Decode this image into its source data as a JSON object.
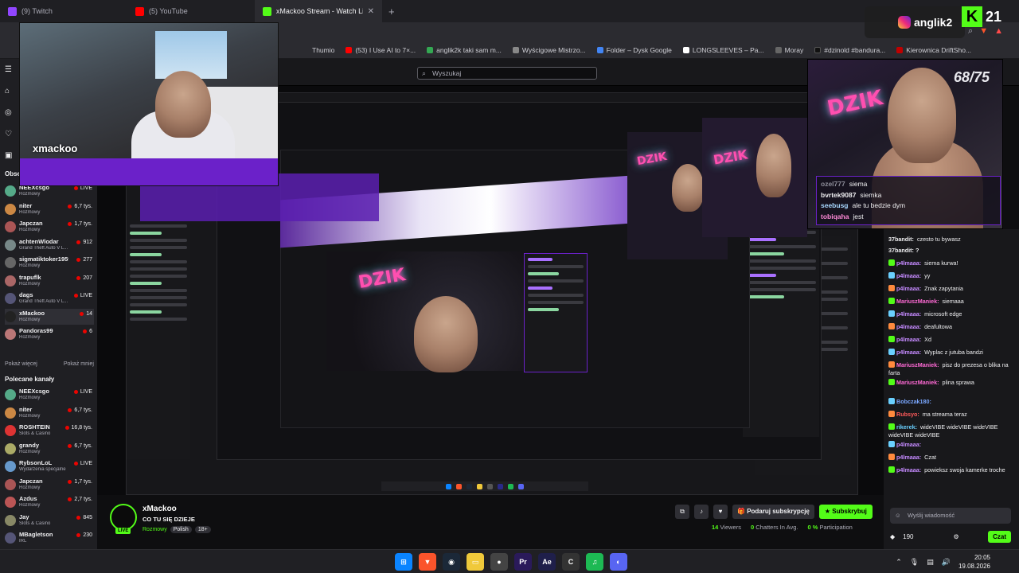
{
  "browser": {
    "tabs": [
      {
        "label": "(9) Twitch",
        "color": "#9146ff"
      },
      {
        "label": "(5) YouTube",
        "color": "#ff0000"
      },
      {
        "label": "xMackoo Stream - Watch Live o",
        "color": "#53fc18"
      }
    ],
    "bookmarks": [
      {
        "label": "Thumio",
        "color": "#3b3b3b"
      },
      {
        "label": "(53) I Use AI to 7×...",
        "color": "#ff0000"
      },
      {
        "label": "anglik2k taki sam m...",
        "color": "#34a853"
      },
      {
        "label": "Wyścigowe Mistrzo...",
        "color": "#888888"
      },
      {
        "label": "Folder – Dysk Google",
        "color": "#4285f4"
      },
      {
        "label": "LONGSLEEVES – Pa...",
        "color": "#ffffff"
      },
      {
        "label": "Moray",
        "color": "#666666"
      },
      {
        "label": "#dzinold #bandura...",
        "color": "#111111"
      },
      {
        "label": "Kierownica DriftSho...",
        "color": "#c00000"
      }
    ]
  },
  "search": {
    "placeholder": "Wyszukaj"
  },
  "sidebar": {
    "followed_title": "Obse",
    "channels": [
      {
        "name": "NEEXcsgo",
        "game": "Rozmowy",
        "viewers": "LIVE",
        "color": "#5a8"
      },
      {
        "name": "niter",
        "game": "Rozmowy",
        "viewers": "6,7 tys.",
        "color": "#c84"
      },
      {
        "name": "Japczan",
        "game": "Rozmowy",
        "viewers": "1,7 tys.",
        "color": "#a55"
      },
      {
        "name": "achtenWlodar",
        "game": "Grand Theft Auto V L...",
        "viewers": "912",
        "color": "#788"
      },
      {
        "name": "sigmatiktoker1959",
        "game": "Rozmowy",
        "viewers": "277",
        "color": "#666"
      },
      {
        "name": "trapuflk",
        "game": "Rozmowy",
        "viewers": "207",
        "color": "#a66"
      },
      {
        "name": "dags",
        "game": "Grand Theft Auto V L...",
        "viewers": "LIVE",
        "color": "#557"
      },
      {
        "name": "xMackoo",
        "game": "Rozmowy",
        "viewers": "14",
        "color": "#222"
      },
      {
        "name": "Pandoras99",
        "game": "Rozmowy",
        "viewers": "6",
        "color": "#b77"
      }
    ],
    "show_more": "Pokaż więcej",
    "show_less": "Pokaż mniej",
    "recommended_title": "Polecane kanały",
    "recommended": [
      {
        "name": "NEEXcsgo",
        "game": "Rozmowy",
        "viewers": "LIVE",
        "color": "#5a8"
      },
      {
        "name": "niter",
        "game": "Rozmowy",
        "viewers": "6,7 tys.",
        "color": "#c84"
      },
      {
        "name": "ROSHTEIN",
        "game": "Slots & Casino",
        "viewers": "16,8 tys.",
        "color": "#d33"
      },
      {
        "name": "grandy",
        "game": "Rozmowy",
        "viewers": "6,7 tys.",
        "color": "#aa6"
      },
      {
        "name": "RybsonLoL",
        "game": "Wydarzenia specjalne",
        "viewers": "LIVE",
        "color": "#69c"
      },
      {
        "name": "Japczan",
        "game": "Rozmowy",
        "viewers": "1,7 tys.",
        "color": "#a55"
      },
      {
        "name": "Azdus",
        "game": "Rozmowy",
        "viewers": "2,7 tys.",
        "color": "#b55"
      },
      {
        "name": "Jay",
        "game": "Slots & Casino",
        "viewers": "845",
        "color": "#886"
      },
      {
        "name": "MBagletson",
        "game": "IRL",
        "viewers": "230",
        "color": "#557"
      }
    ]
  },
  "overlay": {
    "cam_left_name": "xmackoo",
    "instagram_user": "anglik2",
    "kick_number": "21",
    "counter": "68/75",
    "neon_sign": "DZIK",
    "overlay_chat": [
      {
        "user": "ozel777",
        "text": "siema",
        "color": "#8e8e9a"
      },
      {
        "user": "bvrtek9087",
        "text": "siemka",
        "color": "#efeff1"
      },
      {
        "user": "seebusg",
        "text": "ale tu bedzie dym",
        "color": "#a8d8ff"
      },
      {
        "user": "tobiqaha",
        "text": "jest",
        "color": "#ff8ad8"
      }
    ]
  },
  "chat": {
    "messages": [
      {
        "user": "37bandit:",
        "text": "czesto tu bywasz",
        "color": "#efeff1"
      },
      {
        "user": "37bandit: ?",
        "text": "",
        "color": "#efeff1"
      },
      {
        "user": "p4lmaaa:",
        "text": "siema kurwa!",
        "color": "#c58aff"
      },
      {
        "user": "p4lmaaa:",
        "text": "yy",
        "color": "#c58aff"
      },
      {
        "user": "p4lmaaa:",
        "text": "Znak zapytania",
        "color": "#c58aff"
      },
      {
        "user": "MariuszManiek:",
        "text": "siemaaa",
        "color": "#ff6ad5"
      },
      {
        "user": "p4lmaaa:",
        "text": "microsoft edge",
        "color": "#c58aff"
      },
      {
        "user": "p4lmaaa:",
        "text": "deafultowa",
        "color": "#c58aff"
      },
      {
        "user": "p4lmaaa:",
        "text": "Xd",
        "color": "#c58aff"
      },
      {
        "user": "p4lmaaa:",
        "text": "Wyplac z jutuba bandzi",
        "color": "#c58aff"
      },
      {
        "user": "MariuszManiek:",
        "text": "pisz do prezesa o blika na farta",
        "color": "#ff6ad5"
      },
      {
        "user": "MariuszManiek:",
        "text": "plina sprawa",
        "color": "#ff6ad5"
      },
      {
        "user": "Bobczak180:",
        "text": "",
        "color": "#7aa7ff"
      },
      {
        "user": "Rubsyo:",
        "text": "ma streama teraz",
        "color": "#ff5a5a"
      },
      {
        "user": "rikerek:",
        "text": "wideVIBE wideVIBE wideVIBE wideVIBE wideVIBE",
        "color": "#6ad0ff"
      },
      {
        "user": "p4lmaaa:",
        "text": "",
        "color": "#c58aff"
      },
      {
        "user": "p4lmaaa:",
        "text": "Czat",
        "color": "#c58aff"
      },
      {
        "user": "p4lmaaa:",
        "text": "powieksz swoja kamerke troche",
        "color": "#c58aff"
      }
    ],
    "input_placeholder": "Wyślij wiadomość",
    "points": "190",
    "send_label": "Czat"
  },
  "stream": {
    "name": "xMackoo",
    "title": "CO TU SIĘ DZIEJE",
    "category": "Rozmowy",
    "language": "Polish",
    "age": "18+",
    "live_badge": "LIVE",
    "gift_label": "Podaruj subskrypcję",
    "sub_label": "Subskrybuj",
    "viewers": "14",
    "viewers_label": "Viewers",
    "chatters": "0",
    "chatters_label": "Chatters In Avg.",
    "participation": "0 %",
    "participation_label": "Participation"
  },
  "system": {
    "time": "20:05",
    "date": "19.08.2026"
  }
}
